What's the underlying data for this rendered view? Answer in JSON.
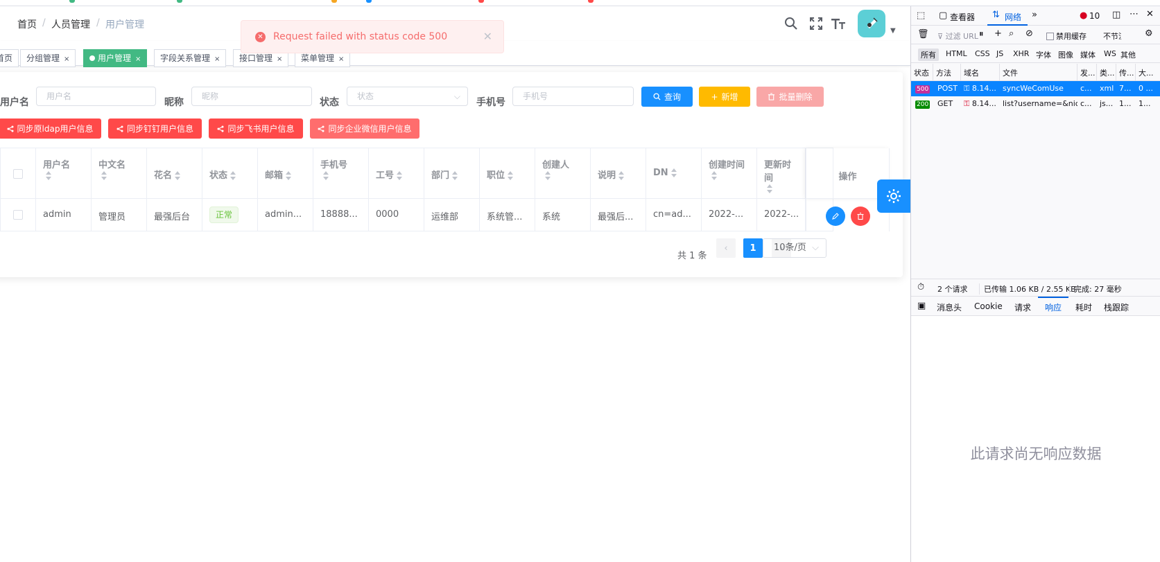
{
  "breadcrumb": [
    "首页",
    "人员管理",
    "用户管理"
  ],
  "toast": {
    "message": "Request failed with status code 500"
  },
  "tags": [
    {
      "label": "首页",
      "closable": false,
      "active": false
    },
    {
      "label": "分组管理",
      "closable": true,
      "active": false
    },
    {
      "label": "用户管理",
      "closable": true,
      "active": true
    },
    {
      "label": "字段关系管理",
      "closable": true,
      "active": false
    },
    {
      "label": "接口管理",
      "closable": true,
      "active": false
    },
    {
      "label": "菜单管理",
      "closable": true,
      "active": false
    }
  ],
  "search": {
    "username": {
      "label": "用户名",
      "placeholder": "用户名"
    },
    "nickname": {
      "label": "昵称",
      "placeholder": "昵称"
    },
    "status": {
      "label": "状态",
      "placeholder": "状态"
    },
    "mobile": {
      "label": "手机号",
      "placeholder": "手机号"
    },
    "query_label": "查询",
    "add_label": "新增",
    "batch_delete_label": "批量删除"
  },
  "sync_buttons": [
    "同步原ldap用户信息",
    "同步钉钉用户信息",
    "同步飞书用户信息",
    "同步企业微信用户信息"
  ],
  "table": {
    "columns": [
      "用户名",
      "中文名",
      "花名",
      "状态",
      "邮箱",
      "手机号",
      "工号",
      "部门",
      "职位",
      "创建人",
      "说明",
      "DN",
      "创建时间",
      "更新时间",
      "操作"
    ],
    "rows": [
      {
        "username": "admin",
        "cn": "管理员",
        "nickname": "最强后台",
        "status": "正常",
        "mail": "admin...",
        "mobile": "18888...",
        "job_no": "0000",
        "dept": "运维部",
        "position": "系统管...",
        "creator": "系统",
        "desc": "最强后...",
        "dn": "cn=ad...",
        "created": "2022-...",
        "updated": "2022-..."
      }
    ]
  },
  "pagination": {
    "total_text": "共 1 条",
    "current_page": "1",
    "page_size": "10条/页",
    "prev": "‹",
    "next": "›"
  },
  "devtools": {
    "tabs": [
      "查看器",
      "网络"
    ],
    "error_count": "10",
    "filter_placeholder": "过滤 URL",
    "disable_cache": "禁用缓存",
    "throttle": "不节流",
    "type_filters": [
      "所有",
      "HTML",
      "CSS",
      "JS",
      "XHR",
      "字体",
      "图像",
      "媒体",
      "WS",
      "其他"
    ],
    "columns": [
      "状态",
      "方法",
      "域名",
      "文件",
      "发...",
      "类...",
      "传...",
      "大..."
    ],
    "requests": [
      {
        "status": "500",
        "method": "POST",
        "domain": "8.14...",
        "file": "syncWeComUse",
        "initiator": "c...",
        "type": "xml",
        "transferred": "7...",
        "size": "0 ..."
      },
      {
        "status": "200",
        "method": "GET",
        "domain": "8.14...",
        "file": "list?username=&nicl",
        "initiator": "c...",
        "type": "js...",
        "transferred": "1...",
        "size": "1..."
      }
    ],
    "summary": {
      "requests": "2 个请求",
      "transferred": "已传输 1.06 KB / 2.55 KB",
      "finish": "完成: 27 毫秒"
    },
    "detail_tabs": [
      "消息头",
      "Cookie",
      "请求",
      "响应",
      "耗时",
      "栈跟踪"
    ],
    "empty_text": "此请求尚无响应数据"
  },
  "colors": {
    "primary": "#1890ff",
    "success": "#42b983",
    "danger": "#ff4949",
    "warning": "#ffba00"
  }
}
